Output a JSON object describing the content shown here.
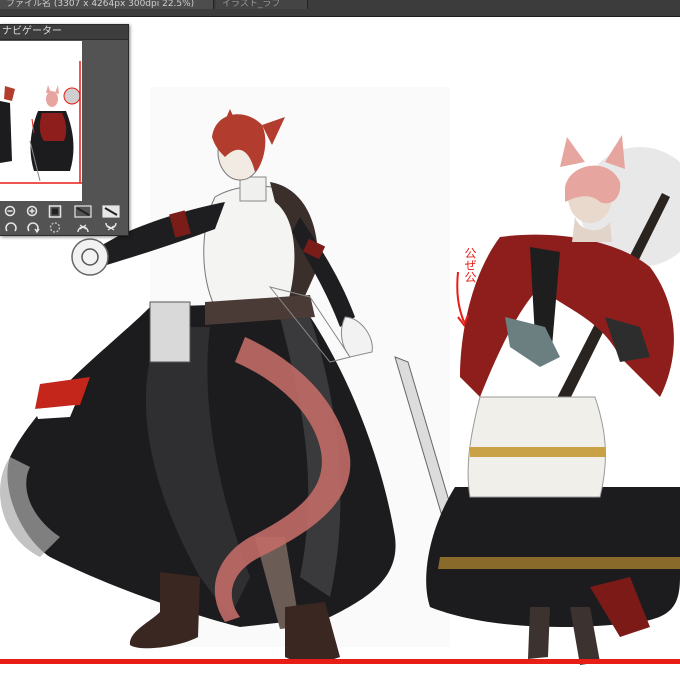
{
  "document_tabs": [
    {
      "label": "ファイル名 (3307 x 4264px 300dpi 22.5%)",
      "active": true
    },
    {
      "label": "イラスト_ラフ",
      "active": false
    }
  ],
  "navigator": {
    "title": "ナビゲーター",
    "buttons": [
      {
        "name": "zoom-out-button",
        "icon": "zoom-out-icon"
      },
      {
        "name": "zoom-in-button",
        "icon": "zoom-in-icon"
      },
      {
        "name": "actual-pixels-button",
        "icon": "square-icon"
      },
      {
        "name": "fit-to-screen-button",
        "icon": "fit-icon"
      },
      {
        "name": "fit-to-window-button",
        "icon": "fit-window-icon"
      },
      {
        "name": "rotate-left-button",
        "icon": "rotate-left-icon"
      },
      {
        "name": "rotate-right-button",
        "icon": "rotate-right-icon"
      },
      {
        "name": "reset-rotation-button",
        "icon": "reset-rotation-icon"
      },
      {
        "name": "flip-horizontal-button",
        "icon": "flip-horizontal-icon"
      },
      {
        "name": "flip-vertical-button",
        "icon": "flip-vertical-icon"
      }
    ]
  },
  "annotation": {
    "text": "公ぜ公"
  },
  "colors": {
    "accent_red": "#e81d16",
    "ui_panel": "#535353",
    "ui_titlebar": "#3d3d3d",
    "cloak_red": "#8e1e1c",
    "hair_pink": "#e7a5a0",
    "skirt_black": "#1c1c1e"
  }
}
